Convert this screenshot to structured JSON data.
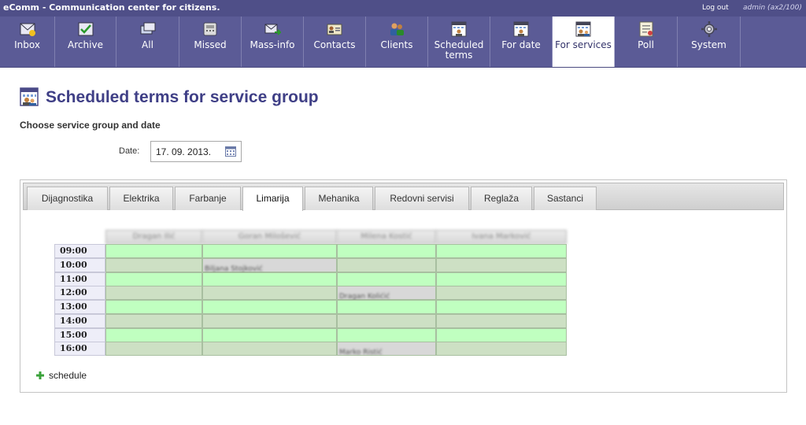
{
  "app": {
    "title": "eComm - Communication center for citizens.",
    "logout": "Log out",
    "user": "admin (ax2/100)"
  },
  "colors": {
    "topbar": "#4f4f88",
    "navbar": "#5b5b96",
    "accent": "#3f3f86",
    "free_slot": "#c0ffc0",
    "booked_slot": "#d8d8d8"
  },
  "nav": [
    {
      "label": "Inbox",
      "icon": "inbox-icon"
    },
    {
      "label": "Archive",
      "icon": "archive-icon"
    },
    {
      "label": "All",
      "icon": "all-messages-icon"
    },
    {
      "label": "Missed",
      "icon": "phone-icon"
    },
    {
      "label": "Mass-info",
      "icon": "mass-mail-icon"
    },
    {
      "label": "Contacts",
      "icon": "contact-card-icon"
    },
    {
      "label": "Clients",
      "icon": "clients-icon"
    },
    {
      "label": "Scheduled terms",
      "icon": "calendar-user-icon"
    },
    {
      "label": "For date",
      "icon": "calendar-user-icon"
    },
    {
      "label": "For services",
      "icon": "calendar-group-icon",
      "active": true
    },
    {
      "label": "Poll",
      "icon": "poll-icon"
    },
    {
      "label": "System",
      "icon": "gear-icon"
    }
  ],
  "page": {
    "title": "Scheduled terms for service group",
    "subtitle": "Choose service group and date",
    "date_label": "Date:",
    "date_value": "17. 09. 2013."
  },
  "tabs": [
    {
      "label": "Dijagnostika"
    },
    {
      "label": "Elektrika"
    },
    {
      "label": "Farbanje"
    },
    {
      "label": "Limarija",
      "active": true
    },
    {
      "label": "Mehanika"
    },
    {
      "label": "Redovni servisi"
    },
    {
      "label": "Reglaža"
    },
    {
      "label": "Sastanci"
    }
  ],
  "schedule": {
    "columns": [
      "Dragan Ilić",
      "Goran Milošević",
      "Milena Kostić",
      "Ivana Marković"
    ],
    "times": [
      "09:00",
      "10:00",
      "11:00",
      "12:00",
      "13:00",
      "14:00",
      "15:00",
      "16:00"
    ],
    "bookings": [
      {
        "time": "10:00",
        "column": 1,
        "name": "Biljana Stojković"
      },
      {
        "time": "12:00",
        "column": 2,
        "name": "Dragan Kolićić"
      },
      {
        "time": "16:00",
        "column": 2,
        "name": "Marko Ristić"
      }
    ],
    "add_label": "schedule"
  }
}
